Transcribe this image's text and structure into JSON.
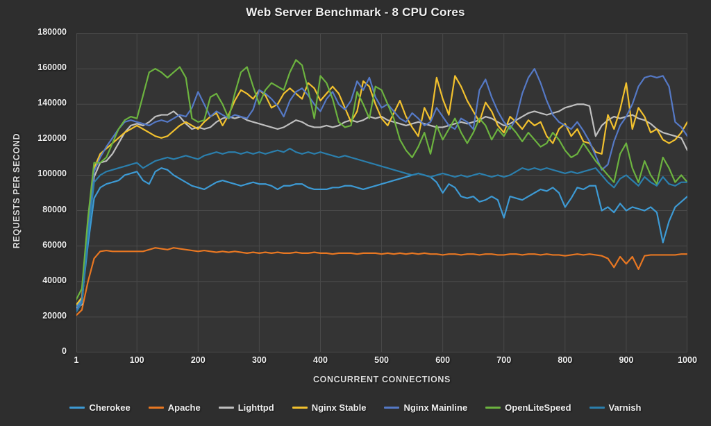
{
  "chart_data": {
    "type": "line",
    "title": "Web Server Benchmark - 8 CPU Cores",
    "xlabel": "CONCURRENT CONNECTIONS",
    "ylabel": "REQUESTS PER SECOND",
    "xlim": [
      1,
      1000
    ],
    "ylim": [
      0,
      180000
    ],
    "ytick_labels": [
      "180000",
      "160000",
      "140000",
      "120000",
      "100000",
      "80000",
      "60000",
      "40000",
      "20000",
      "0"
    ],
    "ytick_values": [
      180000,
      160000,
      140000,
      120000,
      100000,
      80000,
      60000,
      40000,
      20000,
      0
    ],
    "xtick_labels": [
      "1",
      "100",
      "200",
      "300",
      "400",
      "500",
      "600",
      "700",
      "800",
      "900",
      "1000"
    ],
    "xtick_values": [
      1,
      100,
      200,
      300,
      400,
      500,
      600,
      700,
      800,
      900,
      1000
    ],
    "grid": true,
    "legend_position": "bottom",
    "background": "#2e2e2e",
    "plot_background": "#343434",
    "x": [
      1,
      10,
      20,
      30,
      40,
      50,
      60,
      70,
      80,
      90,
      100,
      110,
      120,
      130,
      140,
      150,
      160,
      170,
      180,
      190,
      200,
      210,
      220,
      230,
      240,
      250,
      260,
      270,
      280,
      290,
      300,
      310,
      320,
      330,
      340,
      350,
      360,
      370,
      380,
      390,
      400,
      410,
      420,
      430,
      440,
      450,
      460,
      470,
      480,
      490,
      500,
      510,
      520,
      530,
      540,
      550,
      560,
      570,
      580,
      590,
      600,
      610,
      620,
      630,
      640,
      650,
      660,
      670,
      680,
      690,
      700,
      710,
      720,
      730,
      740,
      750,
      760,
      770,
      780,
      790,
      800,
      810,
      820,
      830,
      840,
      850,
      860,
      870,
      880,
      890,
      900,
      910,
      920,
      930,
      940,
      950,
      960,
      970,
      980,
      990,
      1000
    ],
    "series": [
      {
        "name": "Cherokee",
        "color": "#3d9ad4",
        "values": [
          26000,
          30000,
          61000,
          87000,
          93000,
          95000,
          96000,
          97000,
          100000,
          101000,
          102000,
          97000,
          95000,
          102000,
          104000,
          103000,
          100000,
          98000,
          96000,
          94000,
          93000,
          92000,
          94000,
          96000,
          97000,
          96000,
          95000,
          94000,
          95000,
          96000,
          95000,
          95000,
          94000,
          92000,
          94000,
          94000,
          95000,
          95000,
          93000,
          92000,
          92000,
          92000,
          93000,
          93000,
          94000,
          94000,
          93000,
          92000,
          93000,
          94000,
          95000,
          96000,
          97000,
          98000,
          99000,
          100000,
          101000,
          100000,
          99000,
          96000,
          90000,
          95000,
          93000,
          88000,
          87000,
          88000,
          85000,
          86000,
          88000,
          86000,
          76000,
          88000,
          87000,
          86000,
          88000,
          90000,
          92000,
          91000,
          93000,
          90000,
          82000,
          87000,
          93000,
          92000,
          94000,
          94000,
          80000,
          82000,
          79000,
          84000,
          80000,
          82000,
          81000,
          80000,
          82000,
          79000,
          62000,
          74000,
          82000,
          85000,
          88000
        ]
      },
      {
        "name": "Apache",
        "color": "#e87722",
        "values": [
          21000,
          24000,
          40000,
          53000,
          57000,
          57500,
          57000,
          57000,
          57000,
          57000,
          57000,
          57000,
          58000,
          59000,
          58500,
          58000,
          59000,
          58500,
          58000,
          57500,
          57000,
          57500,
          57000,
          56500,
          57000,
          56500,
          57000,
          56500,
          56000,
          56500,
          56000,
          56500,
          56000,
          56500,
          56000,
          56000,
          56500,
          56000,
          56000,
          56500,
          56000,
          56000,
          55500,
          56000,
          56000,
          56000,
          55500,
          56000,
          56000,
          56000,
          55500,
          56000,
          55500,
          56000,
          55500,
          56000,
          55500,
          56000,
          55500,
          55500,
          55000,
          55500,
          55500,
          55000,
          55500,
          55500,
          55000,
          55500,
          55500,
          55000,
          55000,
          55500,
          55500,
          55000,
          55500,
          55500,
          55000,
          55500,
          55000,
          55000,
          54500,
          55000,
          55500,
          55000,
          55500,
          55000,
          54500,
          53000,
          48000,
          54000,
          50000,
          54000,
          47000,
          54500,
          55000,
          55000,
          55000,
          55000,
          55000,
          55500,
          55500
        ]
      },
      {
        "name": "Lighttpd",
        "color": "#bfbfbf",
        "values": [
          25000,
          27000,
          69000,
          99000,
          107000,
          108000,
          112000,
          118000,
          124000,
          128000,
          129000,
          128000,
          130000,
          133000,
          134000,
          134000,
          136000,
          133000,
          129000,
          126000,
          127000,
          126000,
          127000,
          130000,
          132000,
          133000,
          132000,
          133000,
          131000,
          130000,
          129000,
          128000,
          127000,
          126000,
          127000,
          129000,
          131000,
          130000,
          128000,
          127000,
          127000,
          128000,
          127000,
          128000,
          130000,
          131000,
          130000,
          131000,
          133000,
          132000,
          133000,
          131000,
          130000,
          129000,
          128000,
          129000,
          130000,
          129000,
          128000,
          127000,
          127000,
          128000,
          129000,
          130000,
          129000,
          130000,
          131000,
          133000,
          132000,
          130000,
          128000,
          129000,
          131000,
          133000,
          135000,
          136000,
          135000,
          134000,
          135000,
          136000,
          138000,
          139000,
          140000,
          140000,
          139000,
          122000,
          128000,
          131000,
          133000,
          132000,
          133000,
          134000,
          132000,
          131000,
          129000,
          126000,
          124000,
          123000,
          122000,
          121000,
          114000
        ]
      },
      {
        "name": "Nginx Stable",
        "color": "#f2c12e",
        "values": [
          27000,
          31000,
          72000,
          104000,
          112000,
          115000,
          118000,
          121000,
          124000,
          126000,
          128000,
          126000,
          124000,
          122000,
          121000,
          122000,
          125000,
          128000,
          130000,
          128000,
          126000,
          130000,
          133000,
          135000,
          128000,
          134000,
          142000,
          148000,
          146000,
          143000,
          148000,
          145000,
          138000,
          140000,
          146000,
          149000,
          146000,
          143000,
          152000,
          149000,
          142000,
          146000,
          150000,
          146000,
          138000,
          130000,
          136000,
          153000,
          150000,
          140000,
          132000,
          128000,
          135000,
          142000,
          133000,
          127000,
          122000,
          138000,
          131000,
          155000,
          143000,
          134000,
          156000,
          150000,
          142000,
          136000,
          130000,
          141000,
          136000,
          128000,
          124000,
          133000,
          130000,
          126000,
          131000,
          128000,
          130000,
          122000,
          118000,
          126000,
          129000,
          122000,
          126000,
          119000,
          118000,
          113000,
          112000,
          134000,
          126000,
          137000,
          152000,
          126000,
          138000,
          133000,
          124000,
          126000,
          120000,
          118000,
          120000,
          124000,
          130000
        ]
      },
      {
        "name": "Nginx Mainline",
        "color": "#5579c6",
        "values": [
          24000,
          29000,
          70000,
          102000,
          110000,
          116000,
          121000,
          126000,
          130000,
          131000,
          130000,
          129000,
          128000,
          130000,
          131000,
          130000,
          132000,
          134000,
          133000,
          138000,
          147000,
          140000,
          133000,
          136000,
          134000,
          132000,
          134000,
          133000,
          132000,
          137000,
          148000,
          146000,
          143000,
          139000,
          133000,
          142000,
          147000,
          149000,
          145000,
          140000,
          136000,
          143000,
          147000,
          140000,
          137000,
          142000,
          153000,
          148000,
          155000,
          144000,
          138000,
          140000,
          136000,
          132000,
          130000,
          135000,
          132000,
          128000,
          130000,
          138000,
          133000,
          128000,
          126000,
          132000,
          130000,
          126000,
          148000,
          154000,
          144000,
          136000,
          130000,
          126000,
          132000,
          146000,
          155000,
          160000,
          152000,
          142000,
          134000,
          130000,
          128000,
          126000,
          130000,
          125000,
          119000,
          111000,
          103000,
          106000,
          119000,
          128000,
          133000,
          140000,
          150000,
          155000,
          156000,
          155000,
          156000,
          150000,
          130000,
          127000,
          122000
        ]
      },
      {
        "name": "OpenLiteSpeed",
        "color": "#6cb33f",
        "values": [
          30000,
          36000,
          76000,
          107000,
          107000,
          110000,
          118000,
          126000,
          131000,
          133000,
          132000,
          145000,
          158000,
          160000,
          158000,
          155000,
          158000,
          161000,
          155000,
          132000,
          130000,
          131000,
          144000,
          146000,
          140000,
          132000,
          146000,
          158000,
          161000,
          150000,
          140000,
          148000,
          152000,
          150000,
          148000,
          158000,
          165000,
          162000,
          148000,
          132000,
          156000,
          152000,
          143000,
          130000,
          127000,
          128000,
          147000,
          140000,
          132000,
          150000,
          148000,
          140000,
          132000,
          120000,
          114000,
          110000,
          116000,
          124000,
          112000,
          128000,
          120000,
          126000,
          132000,
          124000,
          118000,
          124000,
          132000,
          128000,
          120000,
          126000,
          122000,
          128000,
          124000,
          119000,
          124000,
          120000,
          116000,
          118000,
          124000,
          120000,
          114000,
          110000,
          112000,
          118000,
          113000,
          108000,
          104000,
          100000,
          96000,
          112000,
          118000,
          104000,
          96000,
          108000,
          100000,
          95000,
          110000,
          104000,
          96000,
          100000,
          96000
        ]
      },
      {
        "name": "Varnish",
        "color": "#2b7fad",
        "values": [
          23000,
          28000,
          66000,
          96000,
          100000,
          102000,
          103000,
          104000,
          105000,
          106000,
          107000,
          104000,
          106000,
          108000,
          109000,
          110000,
          109000,
          110000,
          111000,
          110000,
          109000,
          111000,
          112000,
          113000,
          112000,
          113000,
          113000,
          112000,
          113000,
          112000,
          113000,
          112000,
          113000,
          114000,
          113000,
          115000,
          113000,
          112000,
          113000,
          112000,
          113000,
          112000,
          111000,
          110000,
          111000,
          110000,
          109000,
          108000,
          107000,
          106000,
          105000,
          104000,
          103000,
          102000,
          101000,
          100000,
          101000,
          100000,
          99000,
          100000,
          101000,
          100000,
          99000,
          100000,
          99000,
          100000,
          101000,
          100000,
          99000,
          100000,
          99000,
          100000,
          102000,
          104000,
          103000,
          104000,
          103000,
          104000,
          103000,
          102000,
          101000,
          102000,
          101000,
          102000,
          103000,
          104000,
          100000,
          96000,
          93000,
          98000,
          100000,
          97000,
          94000,
          99000,
          96000,
          94000,
          99000,
          95000,
          94000,
          96000,
          96000
        ]
      }
    ]
  }
}
